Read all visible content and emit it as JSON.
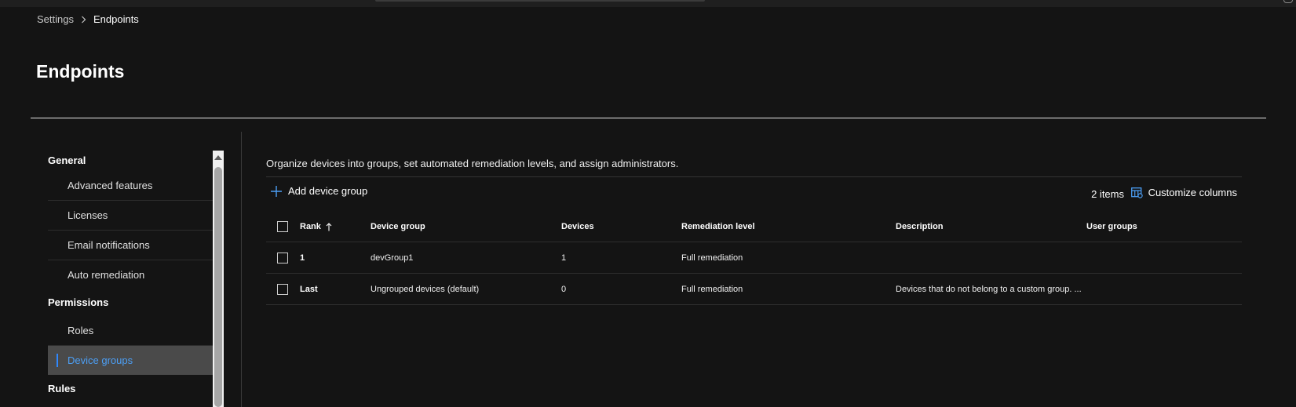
{
  "breadcrumb": {
    "parent": "Settings",
    "current": "Endpoints"
  },
  "page": {
    "title": "Endpoints",
    "description": "Organize devices into groups, set automated remediation levels, and assign administrators."
  },
  "sidebar": {
    "sections": [
      {
        "title": "General",
        "items": [
          "Advanced features",
          "Licenses",
          "Email notifications",
          "Auto remediation"
        ]
      },
      {
        "title": "Permissions",
        "items": [
          "Roles",
          "Device groups"
        ]
      },
      {
        "title": "Rules",
        "items": []
      }
    ],
    "selected_item": "Device groups"
  },
  "toolbar": {
    "add_label": "Add device group",
    "items_count": "2 items",
    "customize_label": "Customize columns"
  },
  "table": {
    "columns": [
      "Rank",
      "Device group",
      "Devices",
      "Remediation level",
      "Description",
      "User groups"
    ],
    "rows": [
      {
        "rank": "1",
        "device_group": "devGroup1",
        "devices": "1",
        "remediation_level": "Full remediation",
        "description": "",
        "user_groups": ""
      },
      {
        "rank": "Last",
        "device_group": "Ungrouped devices (default)",
        "devices": "0",
        "remediation_level": "Full remediation",
        "description": "Devices that do not belong to a custom group. ...",
        "user_groups": ""
      }
    ]
  },
  "icons": {
    "breadcrumb_separator": "chevron-right-icon",
    "add": "plus-icon",
    "customize": "customize-columns-icon",
    "sort": "sort-ascending-icon",
    "scroll_up": "arrow-up-icon"
  },
  "colors": {
    "background": "#141414",
    "accent": "#2f88ff",
    "selected_text": "#4c9ff5",
    "selected_bg": "#4a4a4a"
  }
}
